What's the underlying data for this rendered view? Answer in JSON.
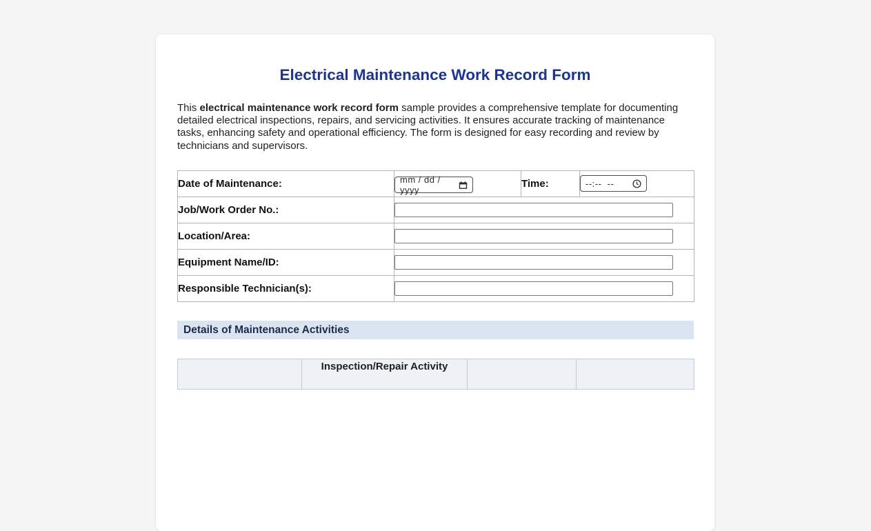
{
  "page": {
    "title": "Electrical Maintenance Work Record Form"
  },
  "intro": {
    "prefix": "This ",
    "bold": "electrical maintenance work record form",
    "rest": " sample provides a comprehensive template for documenting detailed electrical inspections, repairs, and servicing activities. It ensures accurate tracking of maintenance tasks, enhancing safety and operational efficiency. The form is designed for easy recording and review by technicians and supervisors."
  },
  "form": {
    "date_label": "Date of Maintenance:",
    "date_placeholder": "mm / dd / yyyy",
    "time_label": "Time:",
    "time_placeholder": "--:--  --",
    "rows": [
      {
        "label": "Job/Work Order No.:",
        "value": ""
      },
      {
        "label": "Location/Area:",
        "value": ""
      },
      {
        "label": "Equipment Name/ID:",
        "value": ""
      },
      {
        "label": "Responsible Technician(s):",
        "value": ""
      }
    ]
  },
  "sections": {
    "details_header": "Details of Maintenance Activities"
  },
  "activities_table": {
    "headers": [
      "",
      "Inspection/Repair Activity",
      "",
      ""
    ]
  },
  "icons": {
    "date": "calendar-icon",
    "time": "clock-icon"
  },
  "colors": {
    "title_blue": "#1b368c",
    "section_header_bg": "#dbe5f2",
    "section_header_text": "#1a2b4a",
    "table_border": "#b3b3b3",
    "activities_header_bg": "#eef1f6",
    "activities_border": "#c4cad3",
    "page_bg": "#f5f5f6",
    "card_bg": "#ffffff"
  }
}
